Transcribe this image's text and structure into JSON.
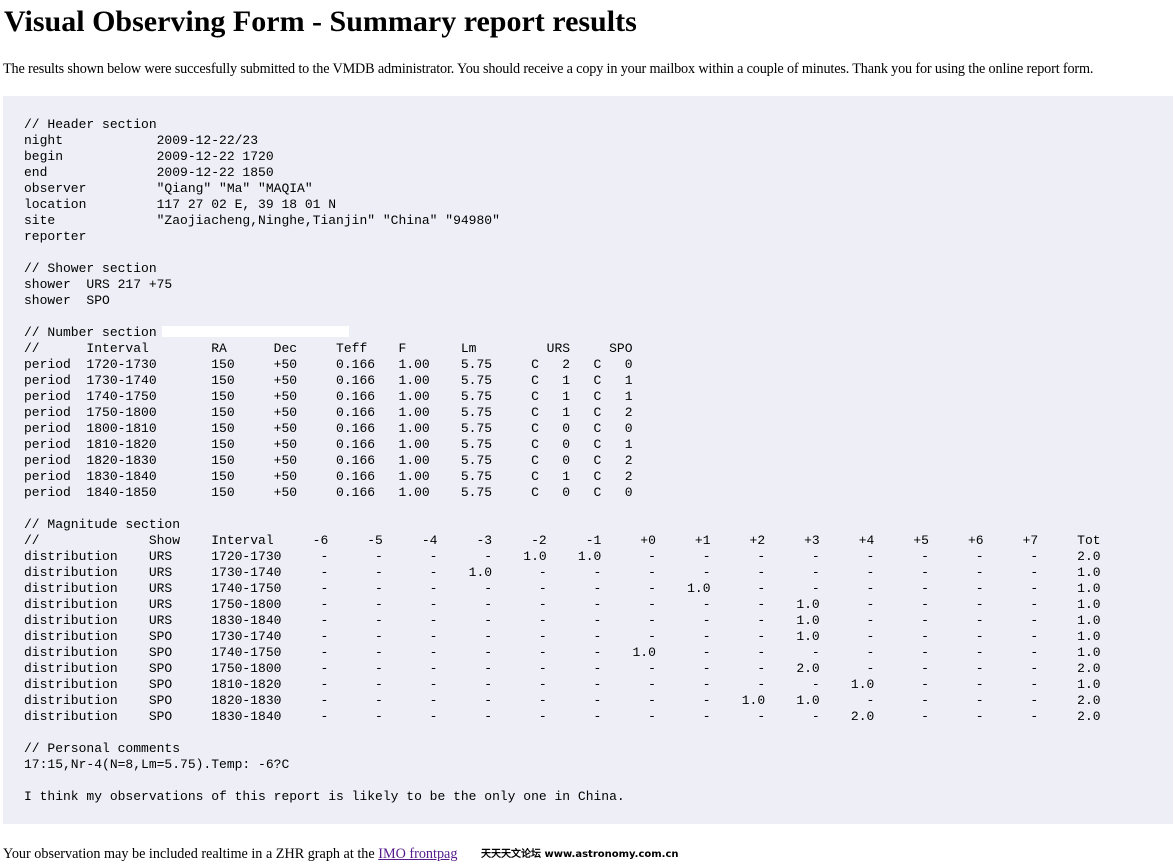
{
  "page": {
    "title": "Visual Observing Form - Summary report results",
    "intro": "The results shown below were succesfully submitted to the VMDB administrator. You should receive a copy in your mailbox within a couple of minutes. Thank you for using the online report form."
  },
  "report": {
    "lines": [
      "// Header section",
      "night            2009-12-22/23",
      "begin            2009-12-22 1720",
      "end              2009-12-22 1850",
      "observer         \"Qiang\" \"Ma\" \"MAQIA\"",
      "location         117 27 02 E, 39 18 01 N",
      "site             \"Zaojiacheng,Ninghe,Tianjin\" \"China\" \"94980\"",
      "reporter",
      "",
      "// Shower section",
      "shower  URS 217 +75",
      "shower  SPO",
      "",
      "// Number section",
      "//      Interval        RA      Dec     Teff    F       Lm         URS     SPO",
      "period  1720-1730       150     +50     0.166   1.00    5.75     C   2   C   0",
      "period  1730-1740       150     +50     0.166   1.00    5.75     C   1   C   1",
      "period  1740-1750       150     +50     0.166   1.00    5.75     C   1   C   1",
      "period  1750-1800       150     +50     0.166   1.00    5.75     C   1   C   2",
      "period  1800-1810       150     +50     0.166   1.00    5.75     C   0   C   0",
      "period  1810-1820       150     +50     0.166   1.00    5.75     C   0   C   1",
      "period  1820-1830       150     +50     0.166   1.00    5.75     C   0   C   2",
      "period  1830-1840       150     +50     0.166   1.00    5.75     C   1   C   2",
      "period  1840-1850       150     +50     0.166   1.00    5.75     C   0   C   0",
      "",
      "// Magnitude section",
      "//              Show    Interval     -6     -5     -4     -3     -2     -1     +0     +1     +2     +3     +4     +5     +6     +7     Tot",
      "distribution    URS     1720-1730     -      -      -      -    1.0    1.0      -      -      -      -      -      -      -      -     2.0",
      "distribution    URS     1730-1740     -      -      -    1.0      -      -      -      -      -      -      -      -      -      -     1.0",
      "distribution    URS     1740-1750     -      -      -      -      -      -      -    1.0      -      -      -      -      -      -     1.0",
      "distribution    URS     1750-1800     -      -      -      -      -      -      -      -      -    1.0      -      -      -      -     1.0",
      "distribution    URS     1830-1840     -      -      -      -      -      -      -      -      -    1.0      -      -      -      -     1.0",
      "distribution    SPO     1730-1740     -      -      -      -      -      -      -      -      -    1.0      -      -      -      -     1.0",
      "distribution    SPO     1740-1750     -      -      -      -      -      -    1.0      -      -      -      -      -      -      -     1.0",
      "distribution    SPO     1750-1800     -      -      -      -      -      -      -      -      -    2.0      -      -      -      -     2.0",
      "distribution    SPO     1810-1820     -      -      -      -      -      -      -      -      -      -    1.0      -      -      -     1.0",
      "distribution    SPO     1820-1830     -      -      -      -      -      -      -      -    1.0    1.0      -      -      -      -     2.0",
      "distribution    SPO     1830-1840     -      -      -      -      -      -      -      -      -      -    2.0      -      -      -     2.0",
      "",
      "// Personal comments",
      "17:15,Nr-4(N=8,Lm=5.75).Temp: -6?C",
      "",
      "I think my observations of this report is likely to be the only one in China."
    ]
  },
  "footer": {
    "text_before_link": "Your observation may be included realtime in a ZHR graph at the ",
    "link_label": "IMO frontpag",
    "watermark": "天天天文论坛 www.astronomy.com.cn"
  }
}
